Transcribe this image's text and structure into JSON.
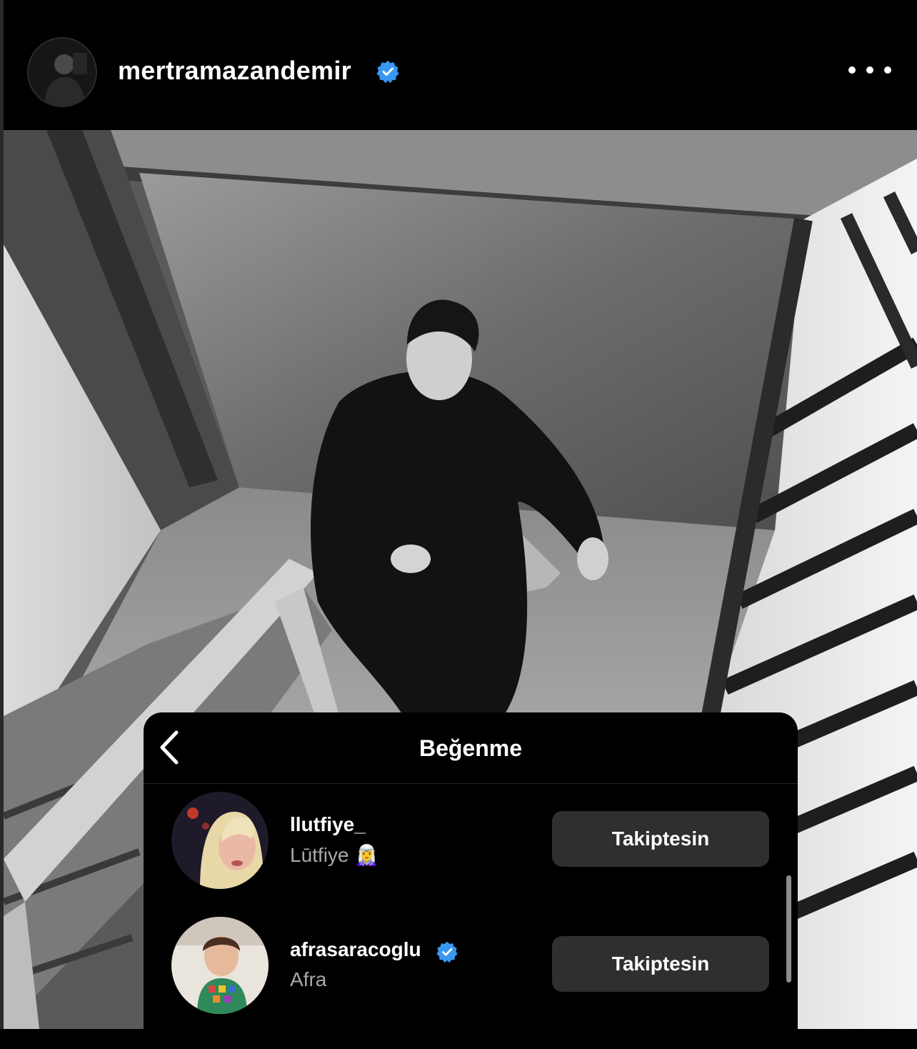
{
  "post": {
    "username": "mertramazandemir",
    "verified": true,
    "icons": {
      "avatar": "profile-photo",
      "verified": "verified-badge-icon",
      "more": "more-options-icon"
    }
  },
  "likes_sheet": {
    "title": "Beğenme",
    "back_icon": "chevron-left-icon",
    "users": [
      {
        "username": "llutfiye_",
        "display_name": "Lūtfiye 🧝‍♀️",
        "verified": false,
        "button_label": "Takiptesin"
      },
      {
        "username": "afrasaracoglu",
        "display_name": "Afra",
        "verified": true,
        "button_label": "Takiptesin"
      }
    ]
  },
  "colors": {
    "background": "#000000",
    "verified_blue": "#3897f0",
    "button_bg": "#2f2f2f",
    "secondary_text": "#a8a8a8"
  }
}
